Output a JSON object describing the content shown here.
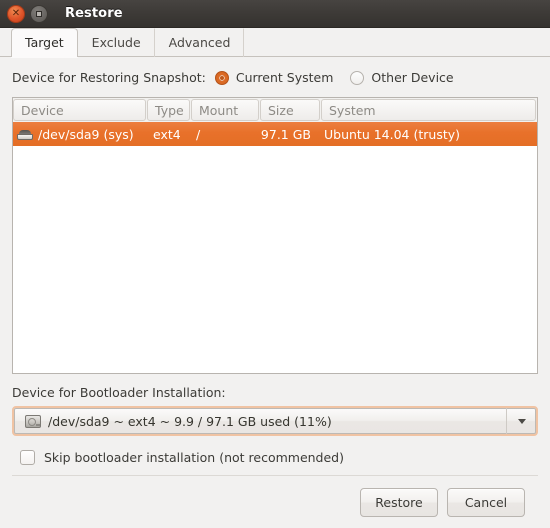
{
  "window": {
    "title": "Restore",
    "controls": {
      "close_label": "×",
      "maximize_label": "□"
    }
  },
  "tabs": [
    {
      "label": "Target",
      "active": true
    },
    {
      "label": "Exclude",
      "active": false
    },
    {
      "label": "Advanced",
      "active": false
    }
  ],
  "target": {
    "restore_device_label": "Device for Restoring Snapshot:",
    "radio_options": [
      {
        "label": "Current System",
        "selected": true
      },
      {
        "label": "Other Device",
        "selected": false
      }
    ],
    "table": {
      "columns": [
        "Device",
        "Type",
        "Mount",
        "Size",
        "System"
      ],
      "rows": [
        {
          "icon": "disk-icon",
          "device": "/dev/sda9 (sys)",
          "type": "ext4",
          "mount": "/",
          "size": "97.1 GB",
          "system": "Ubuntu 14.04 (trusty)",
          "selected": true
        }
      ]
    },
    "bootloader_label": "Device for Bootloader Installation:",
    "bootloader_value": "/dev/sda9 ~ ext4 ~ 9.9 / 97.1 GB used (11%)",
    "bootloader_icon": "hard-drive-icon",
    "skip_bootloader": {
      "label": "Skip bootloader installation (not recommended)",
      "checked": false
    }
  },
  "actions": {
    "restore_label": "Restore",
    "cancel_label": "Cancel"
  },
  "colors": {
    "selection_orange": "#e8712a",
    "titlebar_dark": "#3d3a37",
    "focus_ring": "#f0c3a3",
    "window_bg": "#f2f1f0"
  }
}
